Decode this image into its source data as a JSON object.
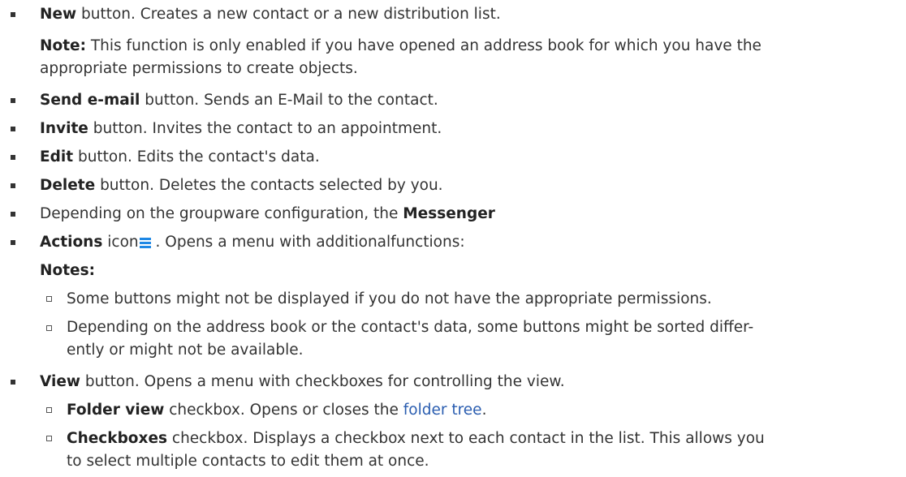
{
  "items": [
    {
      "bold": "New",
      "text": " button. Creates a new contact or a new distribution list.",
      "note_bold": "Note:",
      "note_line1": " This function is only enabled if you have opened an address book for which you have the",
      "note_line2": "appropriate permissions to create objects."
    },
    {
      "bold": "Send e-mail",
      "text": " button. Sends an E-Mail to the contact."
    },
    {
      "bold": "Invite",
      "text": " button. Invites the contact to an appointment."
    },
    {
      "bold": "Edit",
      "text": " button. Edits the contact's data."
    },
    {
      "bold": "Delete",
      "text": " button. Deletes the contacts selected by you."
    },
    {
      "text": "Depending on the groupware configuration, the ",
      "bold": "Messenger"
    },
    {
      "bold": "Actions",
      "text_before_icon": " icon",
      "icon": "hamburger-menu-icon",
      "icon_color": "#1e88e5",
      "text_after_icon": " . Opens a menu with additionalfunctions:",
      "notes_title": "Notes:",
      "notes": [
        {
          "text": "Some buttons might not be displayed if you do not have the appropriate permissions."
        },
        {
          "line1": "Depending on the address book or the contact's data, some buttons might be sorted differ-",
          "line2": "ently or might not be available."
        }
      ]
    },
    {
      "bold": "View",
      "text": " button. Opens a menu with checkboxes for controlling the view.",
      "sub": [
        {
          "bold": "Folder view",
          "text": " checkbox. Opens or closes the ",
          "link": "folder tree",
          "after": "."
        },
        {
          "bold": "Checkboxes",
          "line1": " checkbox. Displays a checkbox next to each contact in the list. This allows you",
          "line2": "to select multiple contacts to edit them at once."
        }
      ]
    }
  ],
  "colors": {
    "text": "#333333",
    "link": "#2a5db0",
    "icon": "#1e88e5"
  }
}
